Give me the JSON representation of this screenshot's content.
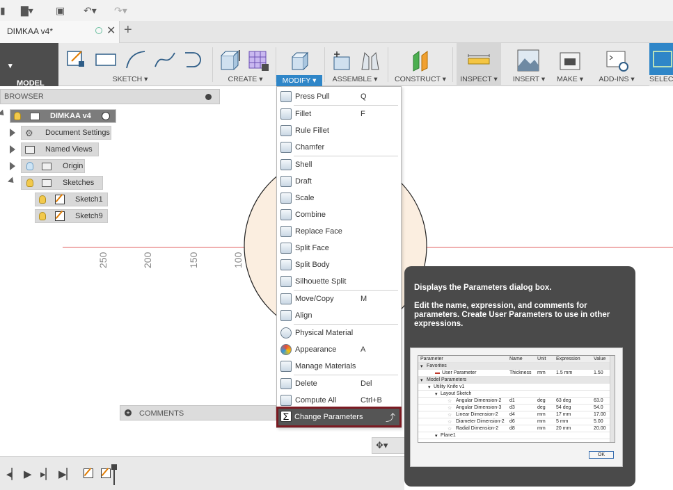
{
  "document": {
    "tab_title": "DIMKAA v4*"
  },
  "quick_access": {
    "icons": [
      "menu-icon",
      "file-icon",
      "save-icon",
      "undo-icon",
      "redo-icon"
    ]
  },
  "ribbon": {
    "workspace": "MODEL",
    "groups": [
      {
        "label": "SKETCH",
        "id": "sketch"
      },
      {
        "label": "CREATE",
        "id": "create"
      },
      {
        "label": "MODIFY",
        "id": "modify"
      },
      {
        "label": "ASSEMBLE",
        "id": "assemble"
      },
      {
        "label": "CONSTRUCT",
        "id": "construct"
      },
      {
        "label": "INSPECT",
        "id": "inspect"
      },
      {
        "label": "INSERT",
        "id": "insert"
      },
      {
        "label": "MAKE",
        "id": "make"
      },
      {
        "label": "ADD-INS",
        "id": "addins"
      },
      {
        "label": "SELECT",
        "id": "select"
      }
    ],
    "accent": "#2f86c8"
  },
  "browser": {
    "title": "BROWSER",
    "root": "DIMKAA v4",
    "items": [
      {
        "label": "Document Settings"
      },
      {
        "label": "Named Views"
      },
      {
        "label": "Origin"
      },
      {
        "label": "Sketches"
      },
      {
        "label": "Sketch1"
      },
      {
        "label": "Sketch9"
      }
    ]
  },
  "canvas": {
    "ruler_labels": [
      "250",
      "200",
      "150",
      "100"
    ]
  },
  "comments": {
    "label": "COMMENTS"
  },
  "modify_menu": {
    "items": [
      {
        "label": "Press Pull",
        "shortcut": "Q"
      },
      {
        "label": "Fillet",
        "shortcut": "F"
      },
      {
        "label": "Rule Fillet",
        "shortcut": ""
      },
      {
        "label": "Chamfer",
        "shortcut": ""
      },
      {
        "label": "Shell",
        "shortcut": ""
      },
      {
        "label": "Draft",
        "shortcut": ""
      },
      {
        "label": "Scale",
        "shortcut": ""
      },
      {
        "label": "Combine",
        "shortcut": ""
      },
      {
        "label": "Replace Face",
        "shortcut": ""
      },
      {
        "label": "Split Face",
        "shortcut": ""
      },
      {
        "label": "Split Body",
        "shortcut": ""
      },
      {
        "label": "Silhouette Split",
        "shortcut": ""
      },
      {
        "label": "Move/Copy",
        "shortcut": "M"
      },
      {
        "label": "Align",
        "shortcut": ""
      },
      {
        "label": "Physical Material",
        "shortcut": ""
      },
      {
        "label": "Appearance",
        "shortcut": "A"
      },
      {
        "label": "Manage Materials",
        "shortcut": ""
      },
      {
        "label": "Delete",
        "shortcut": "Del"
      },
      {
        "label": "Compute All",
        "shortcut": "Ctrl+B"
      },
      {
        "label": "Change Parameters",
        "shortcut": ""
      }
    ],
    "highlight_border": "#7b1a22"
  },
  "tooltip": {
    "heading": "Displays the Parameters dialog box.",
    "body": "Edit the name, expression, and comments for parameters. Create User Parameters to use in other expressions.",
    "preview": {
      "headers": [
        "Parameter",
        "Name",
        "Unit",
        "Expression",
        "Value"
      ],
      "rows": [
        {
          "p": "Favorites",
          "n": "",
          "u": "",
          "e": "",
          "v": ""
        },
        {
          "p": "User Parameter",
          "n": "Thickness",
          "u": "mm",
          "e": "1.5 mm",
          "v": "1.50"
        },
        {
          "p": "Model Parameters",
          "n": "",
          "u": "",
          "e": "",
          "v": ""
        },
        {
          "p": "Utility Knife v1",
          "n": "",
          "u": "",
          "e": "",
          "v": ""
        },
        {
          "p": "Layout Sketch",
          "n": "",
          "u": "",
          "e": "",
          "v": ""
        },
        {
          "p": "Angular Dimension-2",
          "n": "d1",
          "u": "deg",
          "e": "63 deg",
          "v": "63.0"
        },
        {
          "p": "Angular Dimension-3",
          "n": "d3",
          "u": "deg",
          "e": "54 deg",
          "v": "54.0"
        },
        {
          "p": "Linear Dimension-2",
          "n": "d4",
          "u": "mm",
          "e": "17 mm",
          "v": "17.00"
        },
        {
          "p": "Diameter Dimension-2",
          "n": "d6",
          "u": "mm",
          "e": "5 mm",
          "v": "5.00"
        },
        {
          "p": "Radial Dimension-2",
          "n": "d8",
          "u": "mm",
          "e": "20 mm",
          "v": "20.00"
        },
        {
          "p": "Plane1",
          "n": "",
          "u": "",
          "e": "",
          "v": ""
        }
      ],
      "ok_label": "OK"
    }
  }
}
